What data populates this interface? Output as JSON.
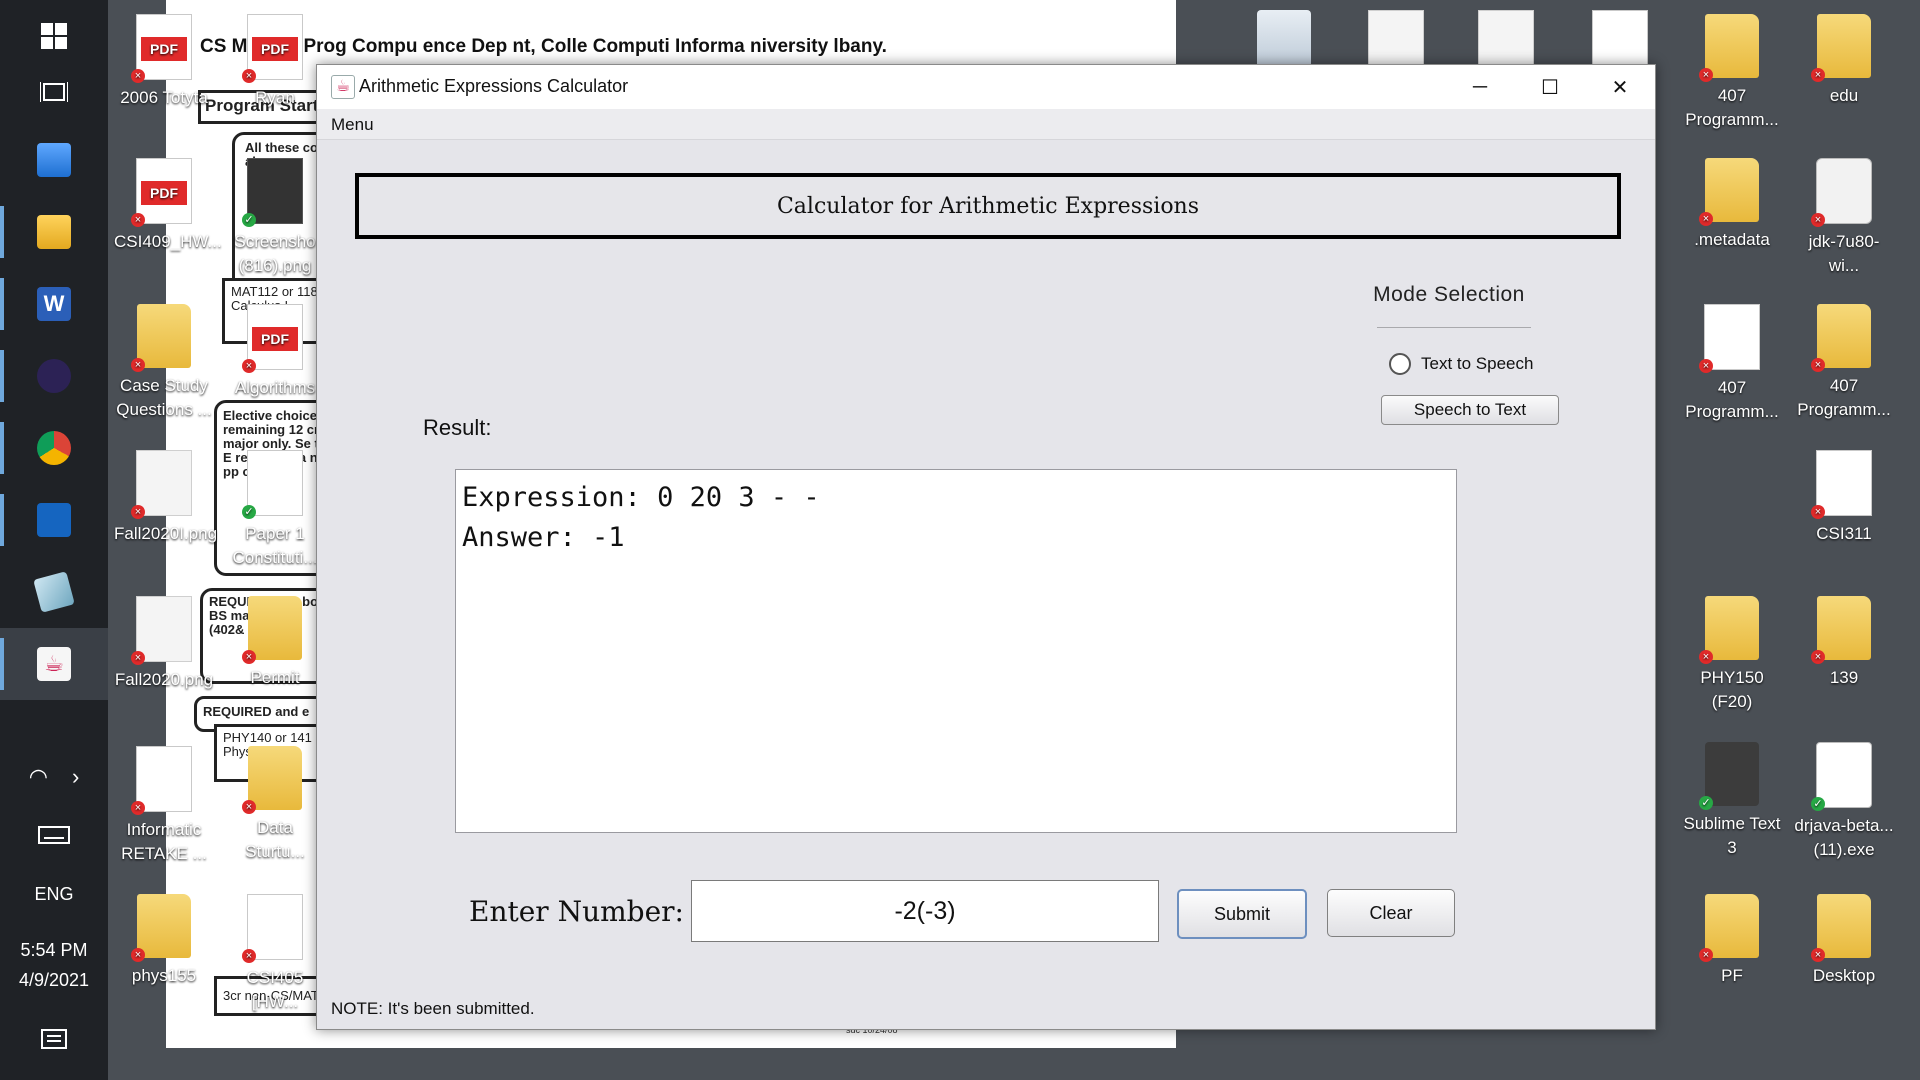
{
  "taskbar": {
    "time": "5:54 PM",
    "date": "4/9/2021",
    "language": "ENG"
  },
  "desktop_icons": [
    {
      "label": "2006 Totyta",
      "icon": "pdf-icon"
    },
    {
      "label": "Ryan",
      "icon": "pdf-icon"
    },
    {
      "label": "CSI409_HW...",
      "icon": "pdf-icon"
    },
    {
      "label": "Screensho (816).png",
      "icon": "image-icon"
    },
    {
      "label": "Case Study Questions ...",
      "icon": "folder-icon"
    },
    {
      "label": "Algorithms",
      "icon": "pdf-icon"
    },
    {
      "label": "Fall2020I.png",
      "icon": "image-icon"
    },
    {
      "label": "Paper 1 Constituti...",
      "icon": "document-icon"
    },
    {
      "label": "Fall2020.png",
      "icon": "image-icon"
    },
    {
      "label": "Permit",
      "icon": "folder-icon"
    },
    {
      "label": "Informatic RETAKE ...",
      "icon": "document-icon"
    },
    {
      "label": "Data Sturtu...",
      "icon": "folder-icon"
    },
    {
      "label": "phys155",
      "icon": "folder-icon"
    },
    {
      "label": "CSI405 [HW...",
      "icon": "document-icon"
    },
    {
      "label": "407 Programm...",
      "icon": "zip-folder-icon"
    },
    {
      "label": "edu",
      "icon": "folder-icon"
    },
    {
      "label": ".metadata",
      "icon": "folder-icon"
    },
    {
      "label": "jdk-7u80-wi...",
      "icon": "java-installer-icon"
    },
    {
      "label": "407 Programm...",
      "icon": "document-icon"
    },
    {
      "label": "407 Programm...",
      "icon": "zip-folder-icon"
    },
    {
      "label": "CSI311",
      "icon": "word-icon"
    },
    {
      "label": "PHY150 (F20)",
      "icon": "folder-icon"
    },
    {
      "label": "139",
      "icon": "folder-icon"
    },
    {
      "label": "Sublime Text 3",
      "icon": "sublime-icon"
    },
    {
      "label": "drjava-beta... (11).exe",
      "icon": "drjava-icon"
    },
    {
      "label": "PF",
      "icon": "folder-icon"
    },
    {
      "label": "Desktop",
      "icon": "folder-icon"
    }
  ],
  "background_doc": {
    "heading": "CS Maj rad Prog Compu ence Dep nt, Colle Computi Informa niversity lbany.",
    "box1": "Program Start",
    "box2": "All these co The BA also",
    "box3": "MAT112 or 118 Calculus I",
    "box4": "Elective choice remaining 12 cr major only. Se the E re optic B a no pp or a r.",
    "box5": "REQUIRED for bot BS ma 15 cre (402& elec",
    "box6": "REQUIRED and e",
    "box7": "PHY140 or 141 Physics I",
    "box8": "3cr non-CS/MAT",
    "footer": "sdc 10/24/08"
  },
  "window": {
    "title": "Arithmetic Expressions Calculator",
    "menu": "Menu",
    "header": "Calculator for Arithmetic Expressions",
    "mode_title": "Mode Selection",
    "radio_label": "Text to Speech",
    "speech_button": "Speech to Text",
    "result_label": "Result:",
    "result_line1": "Expression: 0 20 3 - -",
    "result_line2": "Answer: -1",
    "enter_label": "Enter Number:",
    "input_value": "-2(-3)",
    "submit_label": "Submit",
    "clear_label": "Clear",
    "note": "NOTE: It's been submitted."
  }
}
